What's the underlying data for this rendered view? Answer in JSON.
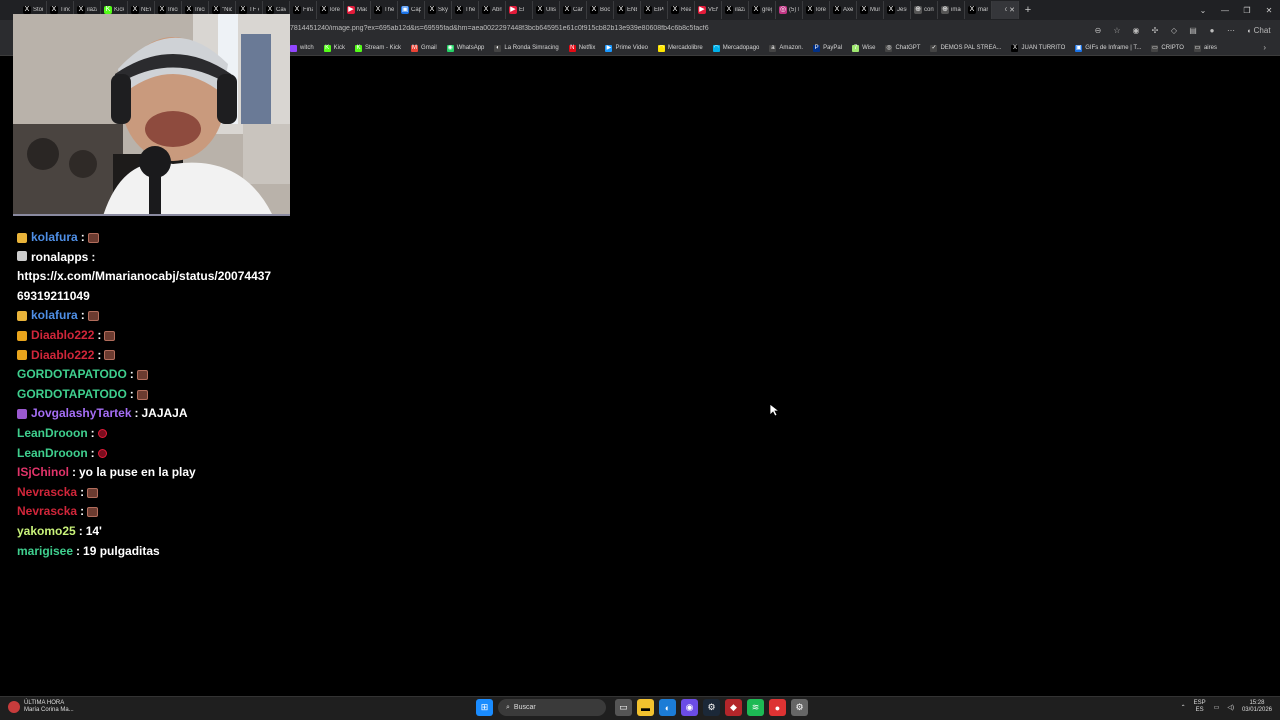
{
  "browser": {
    "tabs": [
      {
        "label": "Story",
        "color": "#000000",
        "glyph": "X"
      },
      {
        "label": "Tino",
        "color": "#000000",
        "glyph": "X"
      },
      {
        "label": "ilázar",
        "color": "#000000",
        "glyph": "X"
      },
      {
        "label": "Kick",
        "color": "#53fc18",
        "glyph": "K"
      },
      {
        "label": "NEW",
        "color": "#000000",
        "glyph": "X"
      },
      {
        "label": "Inicio",
        "color": "#000000",
        "glyph": "X"
      },
      {
        "label": "Inicio",
        "color": "#000000",
        "glyph": "X"
      },
      {
        "label": "\"Nicu",
        "color": "#000000",
        "glyph": "X"
      },
      {
        "label": "TF er",
        "color": "#000000",
        "glyph": "X"
      },
      {
        "label": "Cave",
        "color": "#000000",
        "glyph": "X"
      },
      {
        "label": "Finan",
        "color": "#000000",
        "glyph": "X"
      },
      {
        "label": "lorem",
        "color": "#000000",
        "glyph": "X"
      },
      {
        "label": "Madi",
        "color": "#e21b3a",
        "glyph": "▶"
      },
      {
        "label": "The V",
        "color": "#000000",
        "glyph": "X"
      },
      {
        "label": "Capt",
        "color": "#1a73e8",
        "glyph": "▣"
      },
      {
        "label": "Skysl",
        "color": "#000000",
        "glyph": "X"
      },
      {
        "label": "The V",
        "color": "#000000",
        "glyph": "X"
      },
      {
        "label": "Abrie",
        "color": "#000000",
        "glyph": "X"
      },
      {
        "label": "El",
        "color": "#e21b3a",
        "glyph": "▶"
      },
      {
        "label": "Ulise",
        "color": "#000000",
        "glyph": "X"
      },
      {
        "label": "Canc",
        "color": "#000000",
        "glyph": "X"
      },
      {
        "label": "Boca",
        "color": "#000000",
        "glyph": "X"
      },
      {
        "label": "ENBA",
        "color": "#000000",
        "glyph": "X"
      },
      {
        "label": "ElPul",
        "color": "#000000",
        "glyph": "X"
      },
      {
        "label": "Real",
        "color": "#000000",
        "glyph": "X"
      },
      {
        "label": "VENE",
        "color": "#e21b3a",
        "glyph": "▶"
      },
      {
        "label": "ilázar",
        "color": "#000000",
        "glyph": "X"
      },
      {
        "label": "greg",
        "color": "#000000",
        "glyph": "X"
      },
      {
        "label": "(5) In",
        "color": "#c13584",
        "glyph": "◎"
      },
      {
        "label": "lorem",
        "color": "#000000",
        "glyph": "X"
      },
      {
        "label": "Axel",
        "color": "#000000",
        "glyph": "X"
      },
      {
        "label": "Muni",
        "color": "#000000",
        "glyph": "X"
      },
      {
        "label": "Jesú",
        "color": "#000000",
        "glyph": "X"
      },
      {
        "label": "conti",
        "color": "#555555",
        "glyph": "⊕"
      },
      {
        "label": "imag",
        "color": "#555555",
        "glyph": "⊕"
      },
      {
        "label": "mari",
        "color": "#000000",
        "glyph": "X"
      },
      {
        "label": "c",
        "color": "#35363a",
        "glyph": " ",
        "active": true
      }
    ],
    "url": "7814451240/image.png?ex=695ab12d&is=69595fad&hm=aea0022297448f3bcb645951e61c0f915cb82b13e939e80608fb4c6b8c5facf6",
    "chat_button": "Chat",
    "bookmarks": [
      {
        "label": "witch",
        "color": "#9146ff",
        "glyph": ""
      },
      {
        "label": "Kick",
        "color": "#53fc18",
        "glyph": "K"
      },
      {
        "label": "Stream - Kick",
        "color": "#53fc18",
        "glyph": "K"
      },
      {
        "label": "Gmail",
        "color": "#ea4335",
        "glyph": "M"
      },
      {
        "label": "WhatsApp",
        "color": "#25d366",
        "glyph": "◉"
      },
      {
        "label": "La Ronda Simracing",
        "color": "#444444",
        "glyph": "◐"
      },
      {
        "label": "Netflix",
        "color": "#e50914",
        "glyph": "N"
      },
      {
        "label": "Prime Video",
        "color": "#1a98ff",
        "glyph": "▶"
      },
      {
        "label": "Mercadolibre",
        "color": "#ffe600",
        "glyph": "◠"
      },
      {
        "label": "Mercadopago",
        "color": "#00b1ea",
        "glyph": "◠"
      },
      {
        "label": "Amazon.",
        "color": "#444444",
        "glyph": "a"
      },
      {
        "label": "PayPal",
        "color": "#003087",
        "glyph": "P"
      },
      {
        "label": "Wise",
        "color": "#9fe870",
        "glyph": "7"
      },
      {
        "label": "ChatGPT",
        "color": "#444444",
        "glyph": "◎"
      },
      {
        "label": "DEMOS PAL STREA...",
        "color": "#444444",
        "glyph": "✓"
      },
      {
        "label": "JUAN TURRITO",
        "color": "#000000",
        "glyph": "X"
      },
      {
        "label": "GIFs de Inframe | T...",
        "color": "#1a73e8",
        "glyph": "▣"
      },
      {
        "label": "CRIPTO",
        "color": "#444444",
        "glyph": "▭"
      },
      {
        "label": "aires",
        "color": "#444444",
        "glyph": "▭"
      }
    ]
  },
  "chat": [
    {
      "badge": "#e8b33a",
      "user": "kolafura",
      "user_color": "#4f8fe6",
      "emote": "brown"
    },
    {
      "badge": "#cccccc",
      "user": "ronalapps",
      "user_color": "#ffffff",
      "text": "https://x.com/Mmarianocabj/status/2007443769319211049",
      "block": true
    },
    {
      "badge": "#e8b33a",
      "user": "kolafura",
      "user_color": "#4f8fe6",
      "emote": "brown"
    },
    {
      "badge": "#e8a41c",
      "user": "Diaablo222",
      "user_color": "#d1263a",
      "emote": "brown"
    },
    {
      "badge": "#e8a41c",
      "user": "Diaablo222",
      "user_color": "#d1263a",
      "emote": "brown"
    },
    {
      "user": "GORDOTAPATODO",
      "user_color": "#3fcf8e",
      "emote": "brown"
    },
    {
      "user": "GORDOTAPATODO",
      "user_color": "#3fcf8e",
      "emote": "brown"
    },
    {
      "badge": "#9b59d0",
      "user": "JovgalashyTartek",
      "user_color": "#a56ef5",
      "text": "JAJAJA"
    },
    {
      "user": "LeanDrooon",
      "user_color": "#3fcf8e",
      "emote": "red"
    },
    {
      "user": "LeanDrooon",
      "user_color": "#3fcf8e",
      "emote": "red"
    },
    {
      "user": "ISjChinol",
      "user_color": "#e2346a",
      "text": "yo la puse en la play"
    },
    {
      "user": "Nevrascka",
      "user_color": "#d1263a",
      "emote": "brown"
    },
    {
      "user": "Nevrascka",
      "user_color": "#d1263a",
      "emote": "brown"
    },
    {
      "user": "yakomo25",
      "user_color": "#c9f27a",
      "text": "14'"
    },
    {
      "user": "marigisee",
      "user_color": "#3fcf8e",
      "text": "19 pulgaditas"
    }
  ],
  "taskbar": {
    "news_title": "ÚLTIMA HORA",
    "news_subtitle": "María Corina Ma...",
    "search_placeholder": "Buscar",
    "lang_top": "ESP",
    "lang_bottom": "ES",
    "time": "15:28",
    "date": "03/01/2026"
  }
}
